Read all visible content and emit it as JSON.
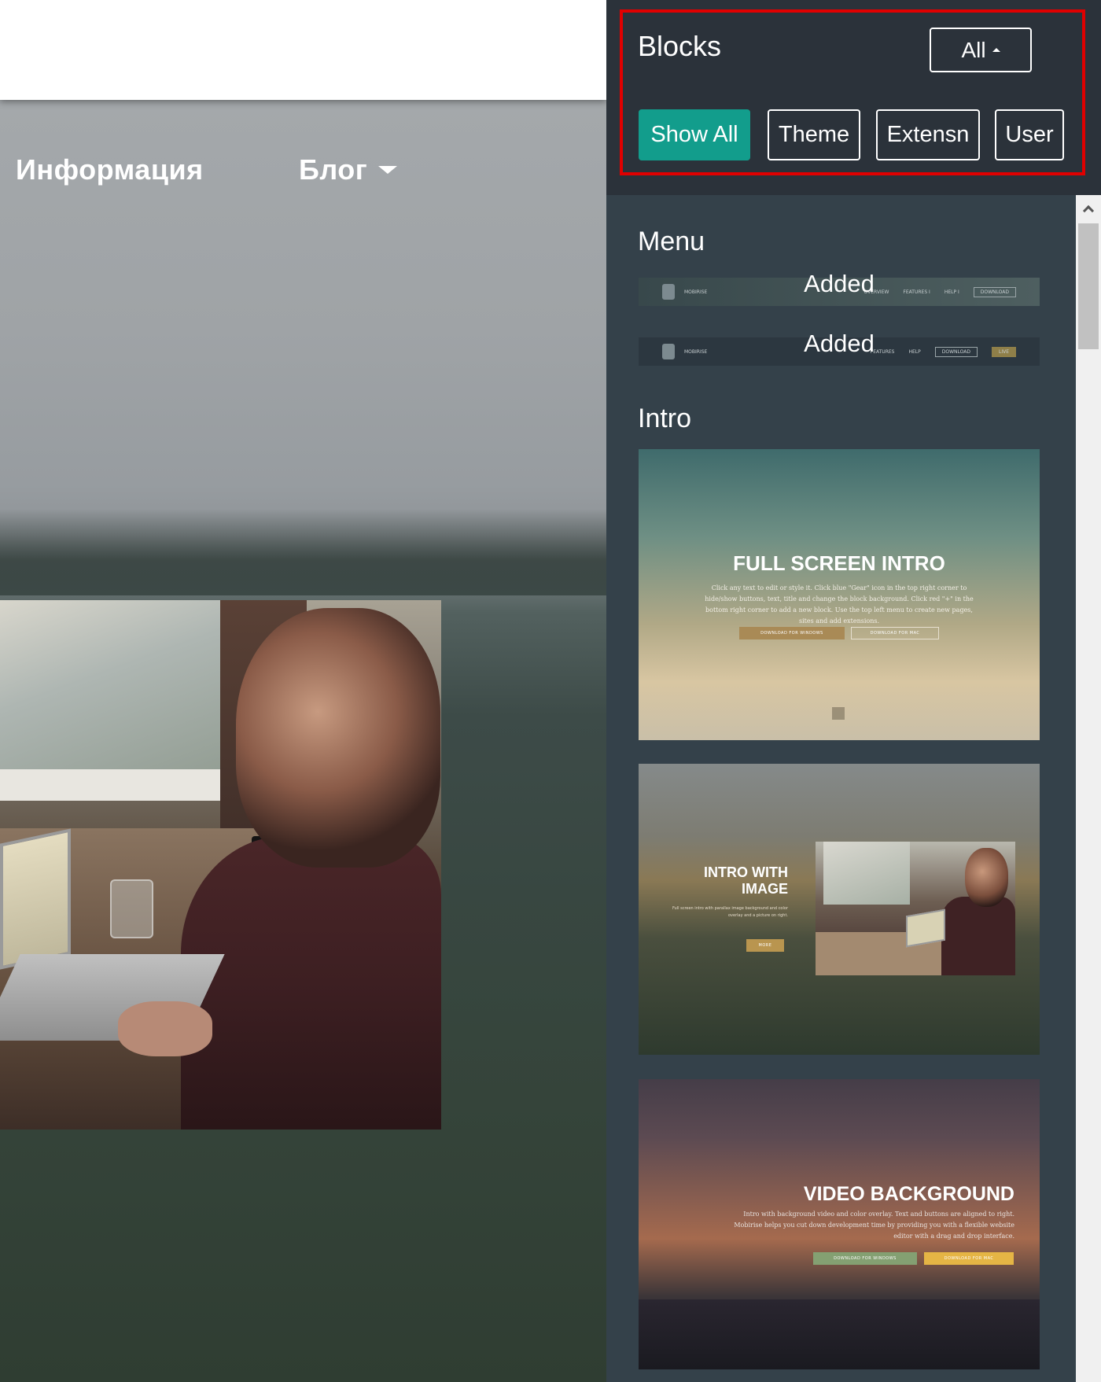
{
  "page_preview": {
    "nav": {
      "info_label": "Информация",
      "blog_label": "Блог"
    },
    "icons": {
      "blog_dropdown": "caret-down-icon"
    }
  },
  "panel": {
    "title": "Blocks",
    "dropdown": {
      "selected": "All",
      "icon": "caret-up-icon"
    },
    "filters": [
      {
        "label": "Show All",
        "active": true
      },
      {
        "label": "Theme",
        "active": false
      },
      {
        "label": "Extensn",
        "active": false
      },
      {
        "label": "User",
        "active": false
      }
    ],
    "colors": {
      "active_filter": "#129d8c",
      "highlight_border": "#e00000",
      "panel_bg": "#34414a",
      "header_bg": "#2b323a"
    },
    "sections": {
      "menu": {
        "title": "Menu",
        "items": [
          {
            "status": "Added",
            "brand": "MOBIRISE",
            "links": [
              "OVERVIEW",
              "FEATURES I",
              "HELP I"
            ],
            "buttons": [
              "DOWNLOAD"
            ]
          },
          {
            "status": "Added",
            "brand": "MOBIRISE",
            "links": [
              "FEATURES",
              "HELP"
            ],
            "buttons": [
              "DOWNLOAD",
              "LIVE"
            ]
          }
        ]
      },
      "intro": {
        "title": "Intro",
        "blocks": [
          {
            "title": "FULL SCREEN INTRO",
            "description": "Click any text to edit or style it. Click blue \"Gear\" icon in the top right corner to hide/show buttons, text, title and change the block background. Click red \"+\" in the bottom right corner to add a new block. Use the top left menu to create new pages, sites and add extensions.",
            "buttons": [
              "DOWNLOAD FOR WINDOWS",
              "DOWNLOAD FOR MAC"
            ]
          },
          {
            "title_line1": "INTRO WITH",
            "title_line2": "IMAGE",
            "description": "Full screen intro with parallax image background and color overlay and a picture on right.",
            "buttons": [
              "MORE"
            ]
          },
          {
            "title": "VIDEO BACKGROUND",
            "description": "Intro with background video and color overlay. Text and buttons are aligned to right. Mobirise helps you cut down development time by providing you with a flexible website editor with a drag and drop interface.",
            "buttons": [
              "DOWNLOAD FOR WINDOWS",
              "DOWNLOAD FOR MAC"
            ]
          }
        ]
      }
    },
    "scrollbar": {
      "icon": "chevron-up-icon"
    }
  }
}
